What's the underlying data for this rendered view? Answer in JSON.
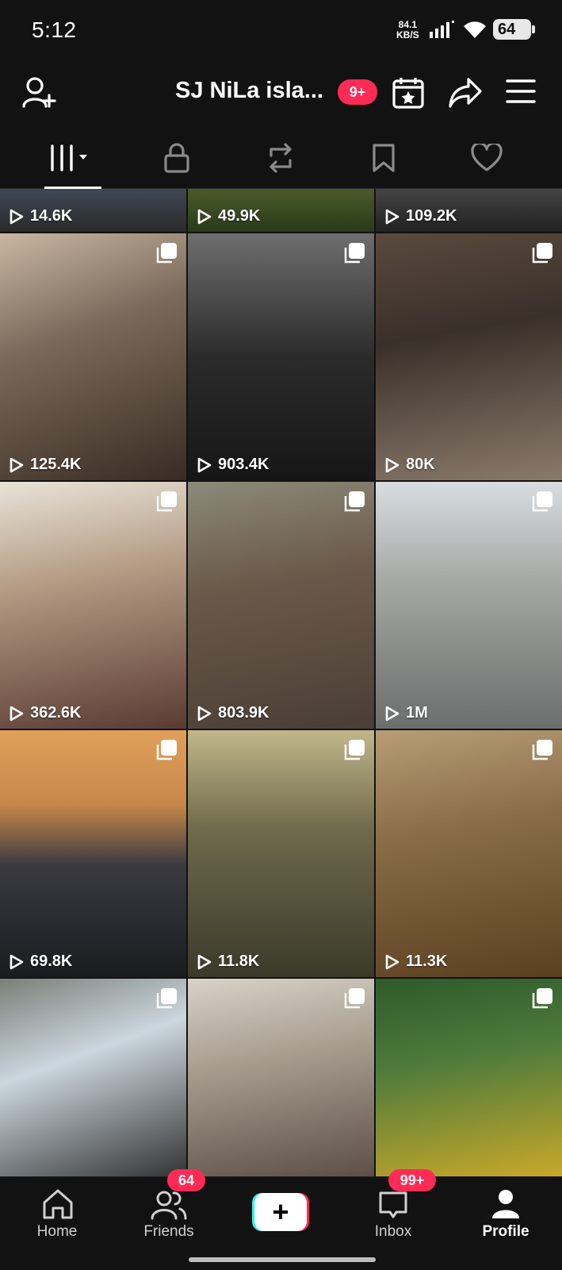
{
  "status": {
    "time": "5:12",
    "speed_top": "84.1",
    "speed_bottom": "KB/S",
    "battery": "64"
  },
  "header": {
    "title": "SJ NiLa isla...",
    "notif_badge": "9+"
  },
  "tabs": [
    "videos-grid",
    "private",
    "reposts",
    "favorites",
    "liked"
  ],
  "grid": {
    "top_row": [
      "14.6K",
      "49.9K",
      "109.2K"
    ],
    "tiles": [
      {
        "views": "125.4K"
      },
      {
        "views": "903.4K"
      },
      {
        "views": "80K"
      },
      {
        "views": "362.6K"
      },
      {
        "views": "803.9K"
      },
      {
        "views": "1M"
      },
      {
        "views": "69.8K"
      },
      {
        "views": "11.8K"
      },
      {
        "views": "11.3K"
      },
      {
        "views": ""
      },
      {
        "views": ""
      },
      {
        "views": ""
      }
    ]
  },
  "nav": {
    "home": "Home",
    "friends": "Friends",
    "friends_badge": "64",
    "inbox": "Inbox",
    "inbox_badge": "99+",
    "profile": "Profile",
    "create": "+"
  },
  "colors": {
    "accent_red": "#ff2b55",
    "cyan": "#25f4ee",
    "background": "#121212"
  }
}
